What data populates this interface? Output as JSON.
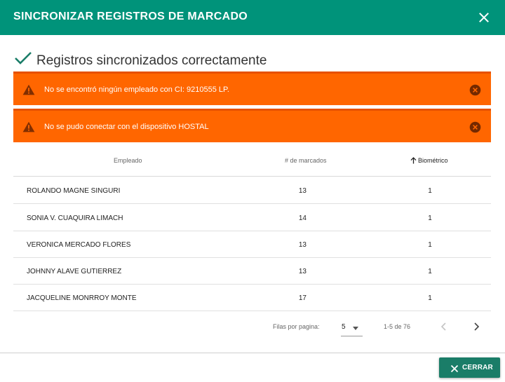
{
  "dialog": {
    "title": "SINCRONIZAR REGISTROS DE MARCADO"
  },
  "success": {
    "message": "Registros sincronizados correctamente"
  },
  "alerts": [
    {
      "text": "No se encontró ningún empleado con CI: 9210555 LP."
    },
    {
      "text": "No se pudo conectar con el dispositivo HOSTAL"
    }
  ],
  "table": {
    "headers": {
      "empleado": "Empleado",
      "marcados": "# de marcados",
      "biometrico": "Biométrico"
    },
    "sort": {
      "column": "biometrico",
      "direction": "ascending"
    },
    "rows": [
      {
        "name": "ROLANDO MAGNE SINGURI",
        "marcados": "13",
        "biometrico": "1"
      },
      {
        "name": "SONIA V. CUAQUIRA LIMACH",
        "marcados": "14",
        "biometrico": "1"
      },
      {
        "name": "VERONICA MERCADO FLORES",
        "marcados": "13",
        "biometrico": "1"
      },
      {
        "name": "JOHNNY ALAVE GUTIERREZ",
        "marcados": "13",
        "biometrico": "1"
      },
      {
        "name": "JACQUELINE MONRROY MONTE",
        "marcados": "17",
        "biometrico": "1"
      }
    ]
  },
  "pagination": {
    "rows_label": "Filas por pagina:",
    "rows_per_page": "5",
    "range": "1-5 de 76"
  },
  "footer": {
    "close_label": "CERRAR"
  },
  "colors": {
    "header": "#00937a",
    "alert": "#ff6600",
    "primary_button": "#1a7d68"
  },
  "icons": {
    "close": "close-icon",
    "check": "check-icon",
    "warning": "warning-icon",
    "alert_close": "close-circle-icon",
    "sort": "arrow-up-icon",
    "prev": "chevron-left-icon",
    "next": "chevron-right-icon",
    "select": "caret-down-icon"
  }
}
